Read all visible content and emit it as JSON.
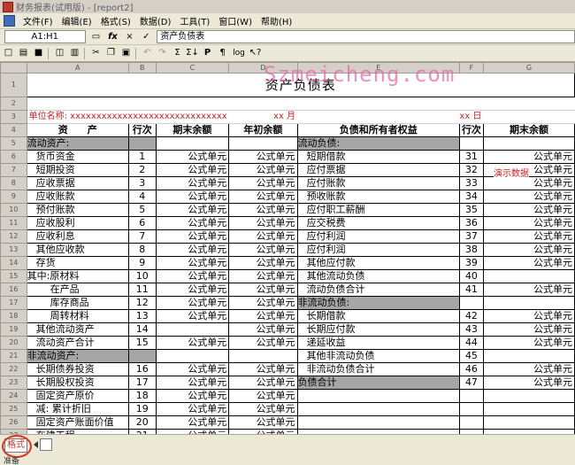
{
  "window": {
    "title": "财务报表(试用版) - [report2]"
  },
  "menu": [
    "文件(F)",
    "编辑(E)",
    "格式(S)",
    "数据(D)",
    "工具(T)",
    "窗口(W)",
    "帮助(H)"
  ],
  "formula": {
    "cell": "A1:H1",
    "fx": "fx",
    "cancel": "×",
    "confirm": "✓",
    "content": "资产负债表"
  },
  "toolbar": {
    "buttons": [
      "new-doc",
      "open",
      "save",
      "print-preview",
      "print",
      "cut",
      "copy",
      "paste",
      "undo",
      "redo",
      "sum",
      "sort",
      "bold",
      "p",
      "log",
      "help"
    ],
    "labels": {
      "p": "P",
      "log": "log"
    }
  },
  "sheet": {
    "columns": [
      "A",
      "B",
      "C",
      "D",
      "E",
      "F",
      "G"
    ],
    "title": "资产负债表",
    "row3": {
      "unit": "单位名称: xxxxxxxxxxxxxxxxxxxxxxxxxxxxxx",
      "month": "xx 月",
      "day": "xx 日"
    },
    "header": {
      "asset": "资　　产",
      "line": "行次",
      "end_balance": "期末余额",
      "begin_balance": "年初余额",
      "liab": "负债和所有者权益",
      "line2": "行次",
      "end_balance2": "期末余额"
    },
    "rows": [
      {
        "n": "5",
        "a": "流动资产:",
        "b": "",
        "c": "",
        "d": "",
        "e": "流动负债:",
        "f": "",
        "g": ""
      },
      {
        "n": "6",
        "a": "货币资金",
        "b": "1",
        "c": "公式单元",
        "d": "公式单元",
        "e": "短期借款",
        "f": "31",
        "g": "公式单元"
      },
      {
        "n": "7",
        "a": "短期投资",
        "b": "2",
        "c": "公式单元",
        "d": "公式单元",
        "e": "应付票据",
        "f": "32",
        "g": "公式单元"
      },
      {
        "n": "8",
        "a": "应收票据",
        "b": "3",
        "c": "公式单元",
        "d": "公式单元",
        "e": "应付账款",
        "f": "33",
        "g": "公式单元"
      },
      {
        "n": "9",
        "a": "应收账款",
        "b": "4",
        "c": "公式单元",
        "d": "公式单元",
        "e": "预收账款",
        "f": "34",
        "g": "公式单元"
      },
      {
        "n": "10",
        "a": "预付账款",
        "b": "5",
        "c": "公式单元",
        "d": "公式单元",
        "e": "应付职工薪酬",
        "f": "35",
        "g": "公式单元"
      },
      {
        "n": "11",
        "a": "应收股利",
        "b": "6",
        "c": "公式单元",
        "d": "公式单元",
        "e": "应交税费",
        "f": "36",
        "g": "公式单元"
      },
      {
        "n": "12",
        "a": "应收利息",
        "b": "7",
        "c": "公式单元",
        "d": "公式单元",
        "e": "应付利润",
        "f": "37",
        "g": "公式单元"
      },
      {
        "n": "13",
        "a": "其他应收款",
        "b": "8",
        "c": "公式单元",
        "d": "公式单元",
        "e": "应付利润",
        "f": "38",
        "g": "公式单元"
      },
      {
        "n": "14",
        "a": "存货",
        "b": "9",
        "c": "公式单元",
        "d": "公式单元",
        "e": "其他应付款",
        "f": "39",
        "g": "公式单元"
      },
      {
        "n": "15",
        "a": "其中:原材料",
        "b": "10",
        "c": "公式单元",
        "d": "公式单元",
        "e": "其他流动负债",
        "f": "40",
        "g": ""
      },
      {
        "n": "16",
        "a": "在产品",
        "b": "11",
        "c": "公式单元",
        "d": "公式单元",
        "e": "流动负债合计",
        "f": "41",
        "g": "公式单元"
      },
      {
        "n": "17",
        "a": "库存商品",
        "b": "12",
        "c": "公式单元",
        "d": "公式单元",
        "e": "非流动负债:",
        "f": "",
        "g": ""
      },
      {
        "n": "18",
        "a": "周转材料",
        "b": "13",
        "c": "公式单元",
        "d": "公式单元",
        "e": "长期借款",
        "f": "42",
        "g": "公式单元"
      },
      {
        "n": "19",
        "a": "其他流动资产",
        "b": "14",
        "c": "",
        "d": "公式单元",
        "e": "长期应付款",
        "f": "43",
        "g": "公式单元"
      },
      {
        "n": "20",
        "a": "流动资产合计",
        "b": "15",
        "c": "公式单元",
        "d": "公式单元",
        "e": "递延收益",
        "f": "44",
        "g": "公式单元"
      },
      {
        "n": "21",
        "a": "非流动资产:",
        "b": "",
        "c": "",
        "d": "",
        "e": "其他非流动负债",
        "f": "45",
        "g": ""
      },
      {
        "n": "22",
        "a": "长期债券投资",
        "b": "16",
        "c": "公式单元",
        "d": "公式单元",
        "e": "非流动负债合计",
        "f": "46",
        "g": "公式单元"
      },
      {
        "n": "23",
        "a": "长期股权投资",
        "b": "17",
        "c": "公式单元",
        "d": "公式单元",
        "e": "负债合计",
        "f": "47",
        "g": "公式单元"
      },
      {
        "n": "24",
        "a": "固定资产原价",
        "b": "18",
        "c": "公式单元",
        "d": "公式单元",
        "e": "",
        "f": "",
        "g": ""
      },
      {
        "n": "25",
        "a": "减: 累计折旧",
        "b": "19",
        "c": "公式单元",
        "d": "公式单元",
        "e": "",
        "f": "",
        "g": ""
      },
      {
        "n": "26",
        "a": "固定资产账面价值",
        "b": "20",
        "c": "公式单元",
        "d": "公式单元",
        "e": "",
        "f": "",
        "g": ""
      },
      {
        "n": "27",
        "a": "在建工程",
        "b": "21",
        "c": "公式单元",
        "d": "公式单元",
        "e": "",
        "f": "",
        "g": ""
      }
    ]
  },
  "overlay": {
    "watermark": "Szmeicheng.com",
    "demo_label": "演示数据"
  },
  "sheet_tab": "格式",
  "status": "准备"
}
